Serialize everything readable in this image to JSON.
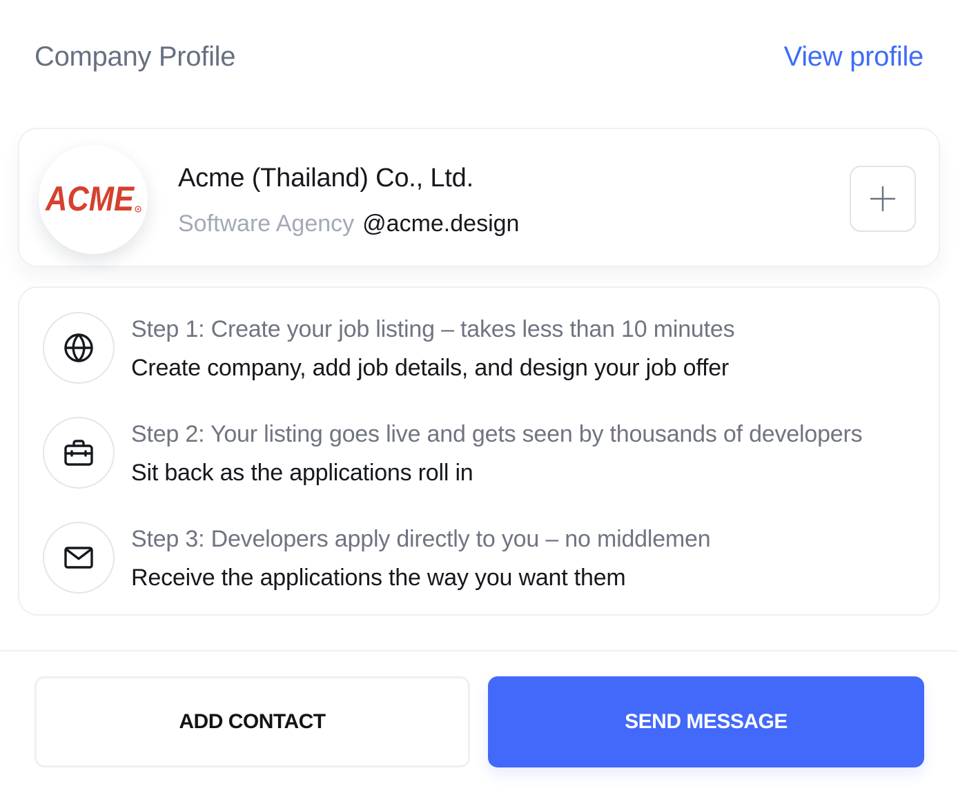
{
  "header": {
    "title": "Company Profile",
    "link_label": "View profile"
  },
  "company": {
    "logo_text": "ACME",
    "name": "Acme (Thailand) Co., Ltd.",
    "category": "Software Agency",
    "handle": "@acme.design",
    "add_icon": "plus-icon"
  },
  "steps": [
    {
      "icon": "globe-icon",
      "title": "Step 1: Create your job listing – takes less than 10 minutes",
      "description": "Create company, add job details, and design your job offer"
    },
    {
      "icon": "briefcase-icon",
      "title": "Step 2: Your listing goes live and gets seen by thousands of developers",
      "description": "Sit back as the applications roll in"
    },
    {
      "icon": "mail-icon",
      "title": "Step 3: Developers apply directly to you – no middlemen",
      "description": "Receive the applications the way you want them"
    }
  ],
  "actions": {
    "secondary_label": "ADD CONTACT",
    "primary_label": "SEND MESSAGE"
  },
  "colors": {
    "accent": "#4369fb",
    "link": "#3d6cf7",
    "logo_red": "#d5412e"
  }
}
